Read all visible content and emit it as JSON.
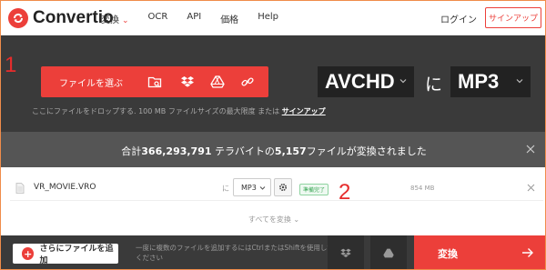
{
  "header": {
    "brand": "Convertio",
    "nav": [
      "変換",
      "OCR",
      "API",
      "価格",
      "Help"
    ],
    "login": "ログイン",
    "signup": "サインアップ"
  },
  "upload": {
    "marker": "1",
    "choose_label": "ファイルを選ぶ",
    "drop_text": "ここにファイルをドロップする. 100 MB ファイルサイズの最大限度 または",
    "drop_link": "サインアップ",
    "from_format": "AVCHD",
    "to_word": "に",
    "to_format": "MP3"
  },
  "stats": {
    "prefix": "合計",
    "bytes": "366,293,791",
    "mid": " テラバイトの",
    "files": "5,157",
    "suffix": "ファイルが変換されました"
  },
  "file_row": {
    "marker": "2",
    "name": "VR_MOVIE.VRO",
    "to_word": "に",
    "format": "MP3",
    "status": "準備完了",
    "size": "854 MB"
  },
  "convert_all": "すべてを変換",
  "bottom": {
    "add_label": "さらにファイルを追加",
    "hint": "一度に複数のファイルを追加するにはCtrlまたはShiftを使用してください",
    "convert_label": "変換"
  },
  "colors": {
    "accent": "#ec3f3a",
    "dark": "#3a3a3a",
    "stats_bg": "#555555",
    "ready": "#3aa655"
  }
}
